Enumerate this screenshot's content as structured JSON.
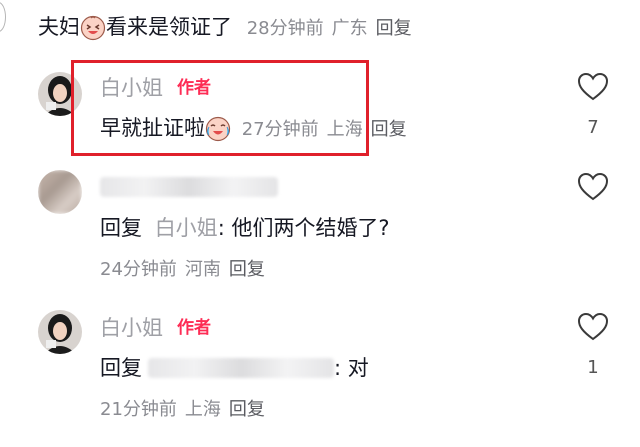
{
  "comments": [
    {
      "text_prefix": "夫妇",
      "text_suffix": "看来是领证了",
      "emoji": "laughing-face-emoji",
      "time": "28分钟前",
      "location": "广东",
      "reply_label": "回复"
    },
    {
      "username": "白小姐",
      "author_badge": "作者",
      "text": "早就扯证啦",
      "emoji": "crying-laughing-face-emoji",
      "time": "27分钟前",
      "location": "上海",
      "reply_label": "回复",
      "likes": "7"
    },
    {
      "reply_prefix": "回复",
      "reply_to": "白小姐",
      "text": ": 他们两个结婚了?",
      "time": "24分钟前",
      "location": "河南",
      "reply_label": "回复",
      "likes": ""
    },
    {
      "username": "白小姐",
      "author_badge": "作者",
      "reply_prefix": "回复",
      "text": ": 对",
      "time": "21分钟前",
      "location": "上海",
      "reply_label": "回复",
      "likes": "1"
    }
  ],
  "icons": {
    "like": "heart-outline-icon"
  },
  "colors": {
    "highlight_border": "#e0202b",
    "author_badge": "#fe2c55",
    "meta_text": "#8a8b91"
  }
}
